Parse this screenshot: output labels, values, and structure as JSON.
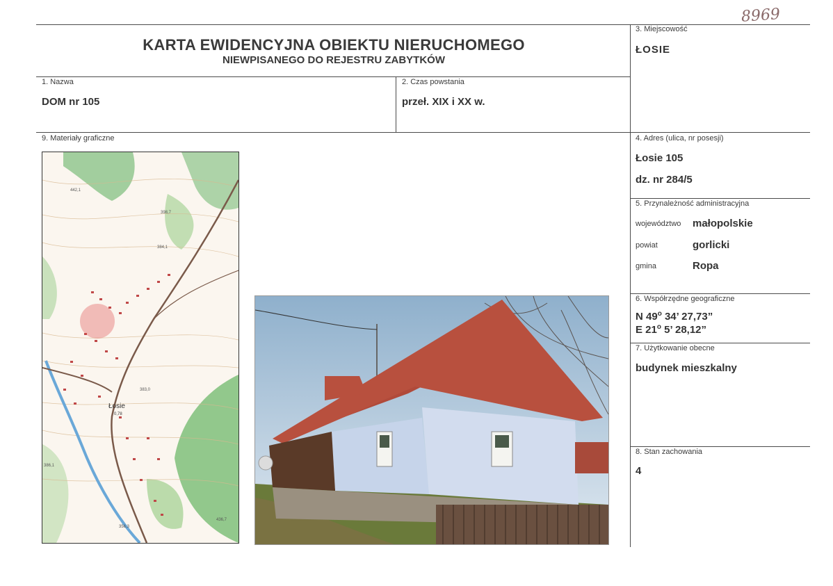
{
  "handwritten_number": "8969",
  "header": {
    "title": "KARTA EWIDENCYJNA OBIEKTU NIERUCHOMEGO",
    "subtitle": "NIEWPISANEGO DO REJESTRU ZABYTKÓW"
  },
  "fields": {
    "locality": {
      "label": "3. Miejscowość",
      "value": "ŁOSIE"
    },
    "name": {
      "label": "1. Nazwa",
      "value": "DOM nr 105"
    },
    "time": {
      "label": "2. Czas powstania",
      "value": "przeł. XIX i XX w."
    },
    "graphics": {
      "label": "9. Materiały graficzne"
    },
    "address": {
      "label": "4. Adres (ulica, nr posesji)",
      "line1": "Łosie 105",
      "line2": "dz. nr 284/5"
    },
    "admin": {
      "label": "5. Przynależność administracyjna",
      "voivodeship_label": "województwo",
      "voivodeship": "małopolskie",
      "county_label": "powiat",
      "county": "gorlicki",
      "commune_label": "gmina",
      "commune": "Ropa"
    },
    "coords": {
      "label": "6. Współrzędne geograficzne",
      "n_prefix": "N 49",
      "n_deg": "o",
      "n_rest": " 34’ 27,73”",
      "e_prefix": "E 21",
      "e_deg": "o",
      "e_rest": " 5’ 28,12”"
    },
    "usage": {
      "label": "7. Użytkowanie obecne",
      "value": "budynek mieszkalny"
    },
    "condition": {
      "label": "8. Stan zachowania",
      "value": "4"
    }
  },
  "map": {
    "place_label": "Łosie",
    "place_sub": "0,78",
    "heights": [
      "442,1",
      "398,7",
      "384,1",
      "383,0",
      "386,1",
      "436,7",
      "356,3",
      "384,1"
    ],
    "colors": {
      "forest": "#8cc48a",
      "meadow": "#cfe6b0",
      "road": "#7a5a4a",
      "river": "#6aa8d8",
      "marker": "#e05050"
    }
  }
}
